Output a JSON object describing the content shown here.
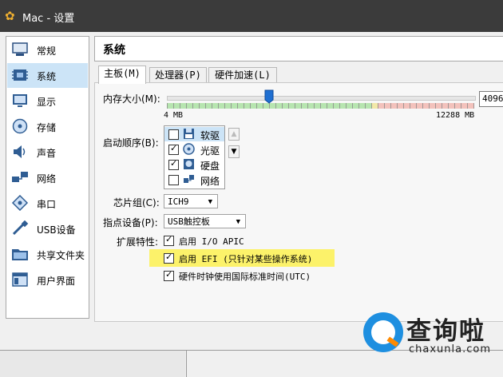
{
  "window": {
    "title": "Mac - 设置"
  },
  "sidebar": {
    "items": [
      {
        "label": "常规",
        "icon": "general-icon"
      },
      {
        "label": "系统",
        "icon": "system-icon",
        "selected": true
      },
      {
        "label": "显示",
        "icon": "display-icon"
      },
      {
        "label": "存储",
        "icon": "storage-icon"
      },
      {
        "label": "声音",
        "icon": "audio-icon"
      },
      {
        "label": "网络",
        "icon": "network-icon"
      },
      {
        "label": "串口",
        "icon": "serial-port-icon"
      },
      {
        "label": "USB设备",
        "icon": "usb-icon"
      },
      {
        "label": "共享文件夹",
        "icon": "shared-folder-icon"
      },
      {
        "label": "用户界面",
        "icon": "user-interface-icon"
      }
    ]
  },
  "panel": {
    "title": "系统"
  },
  "tabs": [
    {
      "label": "主板(M)",
      "active": true
    },
    {
      "label": "处理器(P)"
    },
    {
      "label": "硬件加速(L)"
    }
  ],
  "motherboard": {
    "memory_label": "内存大小(M):",
    "memory_min": "4 MB",
    "memory_max": "12288 MB",
    "memory_value": "4096",
    "memory_fraction": 0.333,
    "boot_order_label": "启动顺序(B):",
    "boot_items": [
      {
        "label": "软驱",
        "checked": false,
        "icon": "floppy-icon"
      },
      {
        "label": "光驱",
        "checked": true,
        "icon": "optical-drive-icon"
      },
      {
        "label": "硬盘",
        "checked": true,
        "icon": "hard-disk-icon"
      },
      {
        "label": "网络",
        "checked": false,
        "icon": "network-boot-icon"
      }
    ],
    "chipset_label": "芯片组(C):",
    "chipset_value": "ICH9",
    "pointing_label": "指点设备(P):",
    "pointing_value": "USB触控板",
    "ext_label": "扩展特性:",
    "ext_items": [
      {
        "label": "启用 I/O APIC",
        "checked": true
      },
      {
        "label": "启用 EFI (只针对某些操作系统)",
        "checked": true
      },
      {
        "label": "硬件时钟使用国际标准时间(UTC)",
        "checked": true
      }
    ]
  },
  "watermark": {
    "title": "查询啦",
    "subtitle": "chaxunla.com"
  },
  "colors": {
    "highlight": "#fcf26a",
    "selection": "#cce4f7",
    "titlebar": "#3b3b3b",
    "brand_blue": "#1e8fe0",
    "brand_orange": "#ff8a00"
  }
}
